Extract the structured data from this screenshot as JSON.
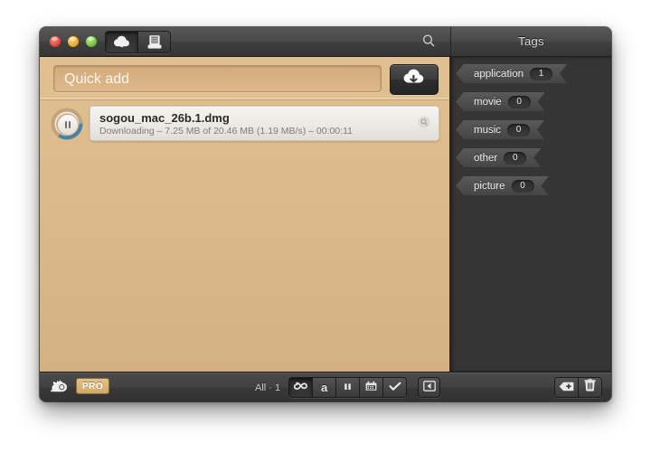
{
  "window": {
    "titlebar": {
      "traffic_lights": [
        {
          "name": "close",
          "color": "#e0443c"
        },
        {
          "name": "minimize",
          "color": "#e8a726"
        },
        {
          "name": "zoom",
          "color": "#6fbf3e"
        }
      ],
      "mode_buttons": [
        {
          "name": "downloads-mode",
          "icon": "cloud-download-icon",
          "active": true
        },
        {
          "name": "tray-mode",
          "icon": "tray-icon",
          "active": false
        }
      ],
      "search_icon": "search-icon",
      "tags_panel_title": "Tags"
    },
    "quick_add": {
      "placeholder": "Quick add",
      "value": "",
      "download_button_icon": "cloud-download-icon"
    },
    "downloads": [
      {
        "name": "sogou_mac_26b.1.dmg",
        "status": "Downloading – 7.25 MB of 20.46 MB (1.19 MB/s) – 00:00:11",
        "progress_percent": 35,
        "control_icon": "pause-icon",
        "reveal_icon": "reveal-in-finder-icon"
      }
    ],
    "tags": [
      {
        "label": "application",
        "count": "1"
      },
      {
        "label": "movie",
        "count": "0"
      },
      {
        "label": "music",
        "count": "0"
      },
      {
        "label": "other",
        "count": "0"
      },
      {
        "label": "picture",
        "count": "0"
      }
    ],
    "bottombar": {
      "speed_limit_icon": "snail-icon",
      "pro_badge": "PRO",
      "filter_count": "All · 1",
      "filter_buttons": [
        {
          "name": "filter-all",
          "icon": "infinity-icon",
          "glyph": "∞",
          "active": true
        },
        {
          "name": "filter-active",
          "icon": "letter-a-icon",
          "glyph": "a",
          "active": false
        },
        {
          "name": "filter-paused",
          "icon": "pause-icon",
          "glyph": "❙❙",
          "active": false
        },
        {
          "name": "filter-scheduled",
          "icon": "calendar-icon",
          "glyph": "▦",
          "active": false
        },
        {
          "name": "filter-completed",
          "icon": "checkmark-icon",
          "glyph": "✓",
          "active": false
        }
      ],
      "panel_toggle_icon": "sidebar-toggle-icon",
      "tag_tools": [
        {
          "name": "add-tag-button",
          "icon": "add-tag-icon"
        },
        {
          "name": "delete-tag-button",
          "icon": "trash-icon"
        }
      ]
    }
  },
  "colors": {
    "main_background": "#dcb988",
    "sidebar_background": "#333333",
    "chrome": "#404040",
    "progress_accent": "#4a87a8",
    "pro_badge": "#d8b278"
  }
}
